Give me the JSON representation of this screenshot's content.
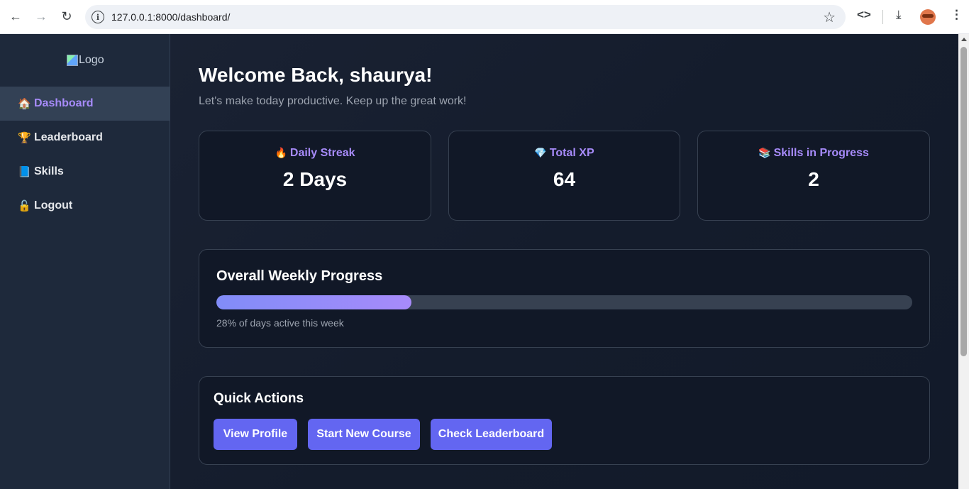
{
  "browser": {
    "url": "127.0.0.1:8000/dashboard/"
  },
  "sidebar": {
    "logo_alt": "Logo",
    "items": [
      {
        "icon": "🏠",
        "label": "Dashboard",
        "active": true
      },
      {
        "icon": "🏆",
        "label": "Leaderboard"
      },
      {
        "icon": "📘",
        "label": "Skills"
      },
      {
        "icon": "🔓",
        "label": "Logout"
      }
    ]
  },
  "header": {
    "title": "Welcome Back, shaurya!",
    "subtitle": "Let's make today productive. Keep up the great work!"
  },
  "stats": [
    {
      "icon": "🔥",
      "label": "Daily Streak",
      "value": "2 Days"
    },
    {
      "icon": "💎",
      "label": "Total XP",
      "value": "64"
    },
    {
      "icon": "📚",
      "label": "Skills in Progress",
      "value": "2"
    }
  ],
  "progress": {
    "title": "Overall Weekly Progress",
    "percent": 28,
    "caption": "28% of days active this week"
  },
  "quick_actions": {
    "title": "Quick Actions",
    "buttons": [
      "View Profile",
      "Start New Course",
      "Check Leaderboard"
    ]
  },
  "colors": {
    "accent": "#a78bfa",
    "button": "#6366f1",
    "card_bg": "#111827",
    "sidebar_bg": "#1e293b"
  }
}
